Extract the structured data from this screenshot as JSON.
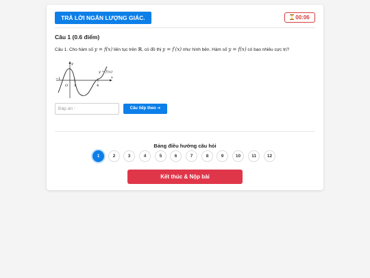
{
  "header": {
    "title": "TRẢ LỜI NGẮN LƯỢNG GIÁC.",
    "timer": "00:06"
  },
  "question": {
    "title": "Câu 1 (0.6 điểm)",
    "text_parts": {
      "p1": "Câu 1. Cho hàm số ",
      "m1": "y = f(x)",
      "p2": " liên tục trên ",
      "m2": "ℝ",
      "p3": ", có đồ thị ",
      "m3": "y = f′(x)",
      "p4": " như hình bên. Hàm số ",
      "m4": "y = f(x)",
      "p5": " có bao nhiêu cực trị?"
    },
    "graph": {
      "y_axis_label": "y",
      "x_axis_label": "x",
      "curve_label": "y = f′(x)",
      "labels": {
        "minus_one": "−1",
        "origin": "O",
        "one": "1",
        "four": "4"
      }
    }
  },
  "answer": {
    "placeholder": "Đáp án :",
    "next_label": "Câu tiếp theo ➔"
  },
  "navigation": {
    "title": "Bảng điều hướng câu hỏi",
    "items": [
      "1",
      "2",
      "3",
      "4",
      "5",
      "6",
      "7",
      "8",
      "9",
      "10",
      "11",
      "12"
    ],
    "active": "1"
  },
  "submit_label": "Kết thúc & Nộp bài",
  "colors": {
    "primary": "#0d7fe8",
    "danger": "#e0364a",
    "timer": "#d93a3a"
  },
  "icons": {
    "timer": "hourglass-icon"
  }
}
